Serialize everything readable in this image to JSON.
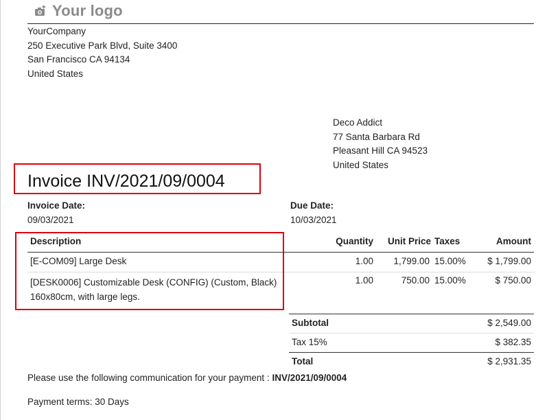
{
  "logo": {
    "text": "Your logo",
    "icon": "camera-plus-icon"
  },
  "company": {
    "name": "YourCompany",
    "street": "250 Executive Park Blvd, Suite 3400",
    "city_line": "San Francisco CA 94134",
    "country": "United States"
  },
  "customer": {
    "name": "Deco Addict",
    "street": "77 Santa Barbara Rd",
    "city_line": "Pleasant Hill CA 94523",
    "country": "United States"
  },
  "invoice": {
    "title": "Invoice INV/2021/09/0004",
    "date_label": "Invoice Date:",
    "date_value": "09/03/2021",
    "due_label": "Due Date:",
    "due_value": "10/03/2021"
  },
  "table": {
    "headers": {
      "description": "Description",
      "quantity": "Quantity",
      "unit_price": "Unit Price",
      "taxes": "Taxes",
      "amount": "Amount"
    },
    "rows": [
      {
        "description": "[E-COM09] Large Desk",
        "quantity": "1.00",
        "unit_price": "1,799.00",
        "taxes": "15.00%",
        "amount": "$ 1,799.00"
      },
      {
        "description": "[DESK0006] Customizable Desk (CONFIG) (Custom, Black) 160x80cm, with large legs.",
        "quantity": "1.00",
        "unit_price": "750.00",
        "taxes": "15.00%",
        "amount": "$ 750.00"
      }
    ]
  },
  "totals": {
    "subtotal_label": "Subtotal",
    "subtotal_value": "$ 2,549.00",
    "tax_label": "Tax 15%",
    "tax_value": "$ 382.35",
    "total_label": "Total",
    "total_value": "$ 2,931.35"
  },
  "footer": {
    "communication_text": "Please use the following communication for your payment : ",
    "communication_ref": "INV/2021/09/0004",
    "payment_terms": "Payment terms: 30 Days"
  },
  "colors": {
    "highlight_box": "#d8000f",
    "logo_gray": "#8a8a8a"
  }
}
